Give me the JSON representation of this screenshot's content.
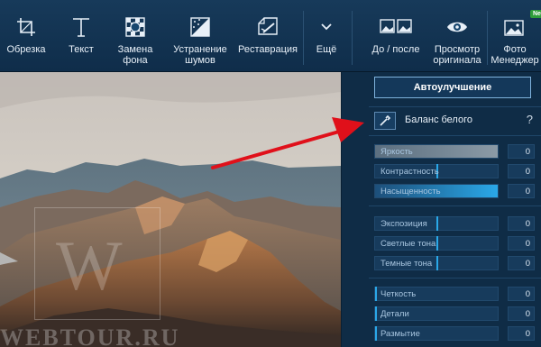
{
  "toolbar": {
    "items": [
      {
        "label": "Обрезка",
        "icon": "crop-icon"
      },
      {
        "label": "Текст",
        "icon": "text-icon"
      },
      {
        "label": "Замена\nфона",
        "icon": "background-replace-icon"
      },
      {
        "label": "Устранение\nшумов",
        "icon": "denoise-icon"
      },
      {
        "label": "Реставрация",
        "icon": "restore-icon"
      },
      {
        "label": "Ещё",
        "icon": "chevron-down-icon"
      },
      {
        "label": "До / после",
        "icon": "before-after-icon"
      },
      {
        "label": "Просмотр\nоригинала",
        "icon": "eye-icon"
      },
      {
        "label": "Фото\nМенеджер",
        "icon": "photo-manager-icon"
      }
    ],
    "new_badge": "New"
  },
  "photo": {
    "watermark": "WEBTOUR.RU",
    "watermark_mark": "W"
  },
  "panel": {
    "auto_enhance": "Автоулучшение",
    "white_balance": "Баланс белого",
    "help": "?",
    "groups": [
      [
        {
          "label": "Яркость",
          "value": "0",
          "fill": 1.0,
          "style": "gray"
        },
        {
          "label": "Контрастность",
          "value": "0",
          "fill": 0.5,
          "style": "thumb"
        },
        {
          "label": "Насыщенность",
          "value": "0",
          "fill": 1.0,
          "style": "blue"
        }
      ],
      [
        {
          "label": "Экспозиция",
          "value": "0",
          "fill": 0.5,
          "style": "thumb"
        },
        {
          "label": "Светлые тона",
          "value": "0",
          "fill": 0.5,
          "style": "thumb"
        },
        {
          "label": "Темные тона",
          "value": "0",
          "fill": 0.5,
          "style": "thumb"
        }
      ],
      [
        {
          "label": "Четкость",
          "value": "0",
          "fill": 0.0,
          "style": "thumb"
        },
        {
          "label": "Детали",
          "value": "0",
          "fill": 0.0,
          "style": "thumb"
        },
        {
          "label": "Размытие",
          "value": "0",
          "fill": 0.0,
          "style": "thumb"
        }
      ]
    ]
  },
  "colors": {
    "accent": "#2aa8e8",
    "annotation_arrow": "#e0101a"
  }
}
